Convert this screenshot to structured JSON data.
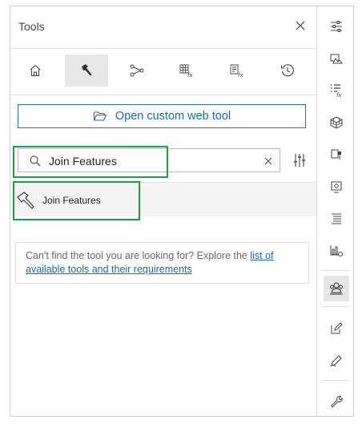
{
  "panel": {
    "title": "Tools",
    "tabs": [
      {
        "name": "home-icon"
      },
      {
        "name": "hammer-icon",
        "active": true
      },
      {
        "name": "flow-icon"
      },
      {
        "name": "table-fx-icon"
      },
      {
        "name": "list-fx-icon"
      },
      {
        "name": "history-icon"
      }
    ],
    "open_button_label": "Open custom web tool",
    "search": {
      "value": "Join Features",
      "placeholder": "Search"
    },
    "result_label": "Join Features",
    "notice": {
      "text": "Can't find the tool you are looking for? Explore the ",
      "link": "list of available tools and their requirements"
    }
  },
  "rail": {
    "items": [
      "sliders-icon",
      "map-layers-icon",
      "list-fx-icon",
      "cube-icon",
      "layer-export-icon",
      "settings-box-icon",
      "align-icon",
      "chart-settings-icon",
      "people-icon",
      "edit-icon",
      "pen-icon",
      "wrench-icon"
    ],
    "active": "people-icon"
  },
  "colors": {
    "accent": "#1f6bb3",
    "highlight": "#1aa04a"
  }
}
